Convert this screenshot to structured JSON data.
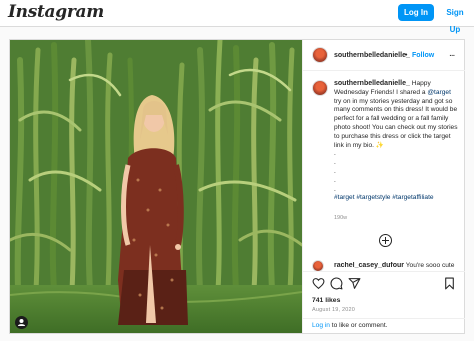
{
  "topbar": {
    "logo": "Instagram",
    "login": "Log In",
    "signup": "Sign Up"
  },
  "post": {
    "username": "southernbelledanielle_",
    "separator": "•",
    "follow": "Follow",
    "more": "...",
    "caption": {
      "username": "southernbelledanielle_",
      "text1": " Happy Wednesday Friends! I shared a ",
      "mention": "@target",
      "text2": " try on in my stories yesterday and got so many comments on this dress! It would be perfect for a fall wedding or a fall family photo shoot! You can check out my stories to purchase this dress or click the target link in my bio. ✨",
      "dots": [
        ".",
        ".",
        ".",
        ".",
        "."
      ],
      "hashtags": "#target #targetstyle #targetaffiliate"
    },
    "time_ago": "190w",
    "comment": {
      "username": "rachel_casey_dufour",
      "text": " You're sooo cute"
    },
    "likes": "741 likes",
    "date": "August 19, 2020",
    "login_prompt": {
      "link": "Log in",
      "text": " to like or comment."
    }
  },
  "icons": [
    "heart-icon",
    "comment-icon",
    "share-icon",
    "bookmark-icon",
    "add-comment-icon",
    "tagged-user-icon"
  ]
}
